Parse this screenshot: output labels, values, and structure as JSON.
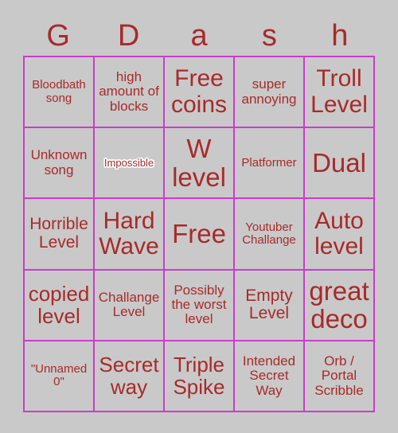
{
  "card": {
    "title_letters": [
      "G",
      "D",
      "a",
      "s",
      "h"
    ],
    "colors": {
      "background": "#c9c9c9",
      "grid_border": "#cc3bcc",
      "text": "#a82a2a",
      "outline": "#ffffff"
    },
    "rows": [
      [
        {
          "text": "Bloodbath song",
          "size": "xs",
          "outlined": false
        },
        {
          "text": "high amount of blocks",
          "size": "s",
          "outlined": false
        },
        {
          "text": "Free coins",
          "size": "xl",
          "outlined": false
        },
        {
          "text": "super annoying",
          "size": "s",
          "outlined": false
        },
        {
          "text": "Troll Level",
          "size": "xl",
          "outlined": false
        }
      ],
      [
        {
          "text": "Unknown song",
          "size": "s",
          "outlined": false
        },
        {
          "text": "Impossible",
          "size": "xxs",
          "outlined": true
        },
        {
          "text": "W level",
          "size": "xxl",
          "outlined": false
        },
        {
          "text": "Platformer",
          "size": "xs",
          "outlined": false
        },
        {
          "text": "Dual",
          "size": "xxl",
          "outlined": false
        }
      ],
      [
        {
          "text": "Horrible Level",
          "size": "m",
          "outlined": false
        },
        {
          "text": "Hard Wave",
          "size": "xl",
          "outlined": false
        },
        {
          "text": "Free",
          "size": "xxl",
          "outlined": false
        },
        {
          "text": "Youtuber Challange",
          "size": "xs",
          "outlined": false
        },
        {
          "text": "Auto level",
          "size": "xl",
          "outlined": false
        }
      ],
      [
        {
          "text": "copied level",
          "size": "l",
          "outlined": false
        },
        {
          "text": "Challange Level",
          "size": "s",
          "outlined": false
        },
        {
          "text": "Possibly the worst level",
          "size": "s",
          "outlined": false
        },
        {
          "text": "Empty Level",
          "size": "m",
          "outlined": false
        },
        {
          "text": "great deco",
          "size": "xxl",
          "outlined": false
        }
      ],
      [
        {
          "text": "\"Unnamed 0\"",
          "size": "xs",
          "outlined": false
        },
        {
          "text": "Secret way",
          "size": "l",
          "outlined": false
        },
        {
          "text": "Triple Spike",
          "size": "l",
          "outlined": false
        },
        {
          "text": "Intended Secret Way",
          "size": "s",
          "outlined": false
        },
        {
          "text": "Orb / Portal Scribble",
          "size": "s",
          "outlined": false
        }
      ]
    ]
  }
}
